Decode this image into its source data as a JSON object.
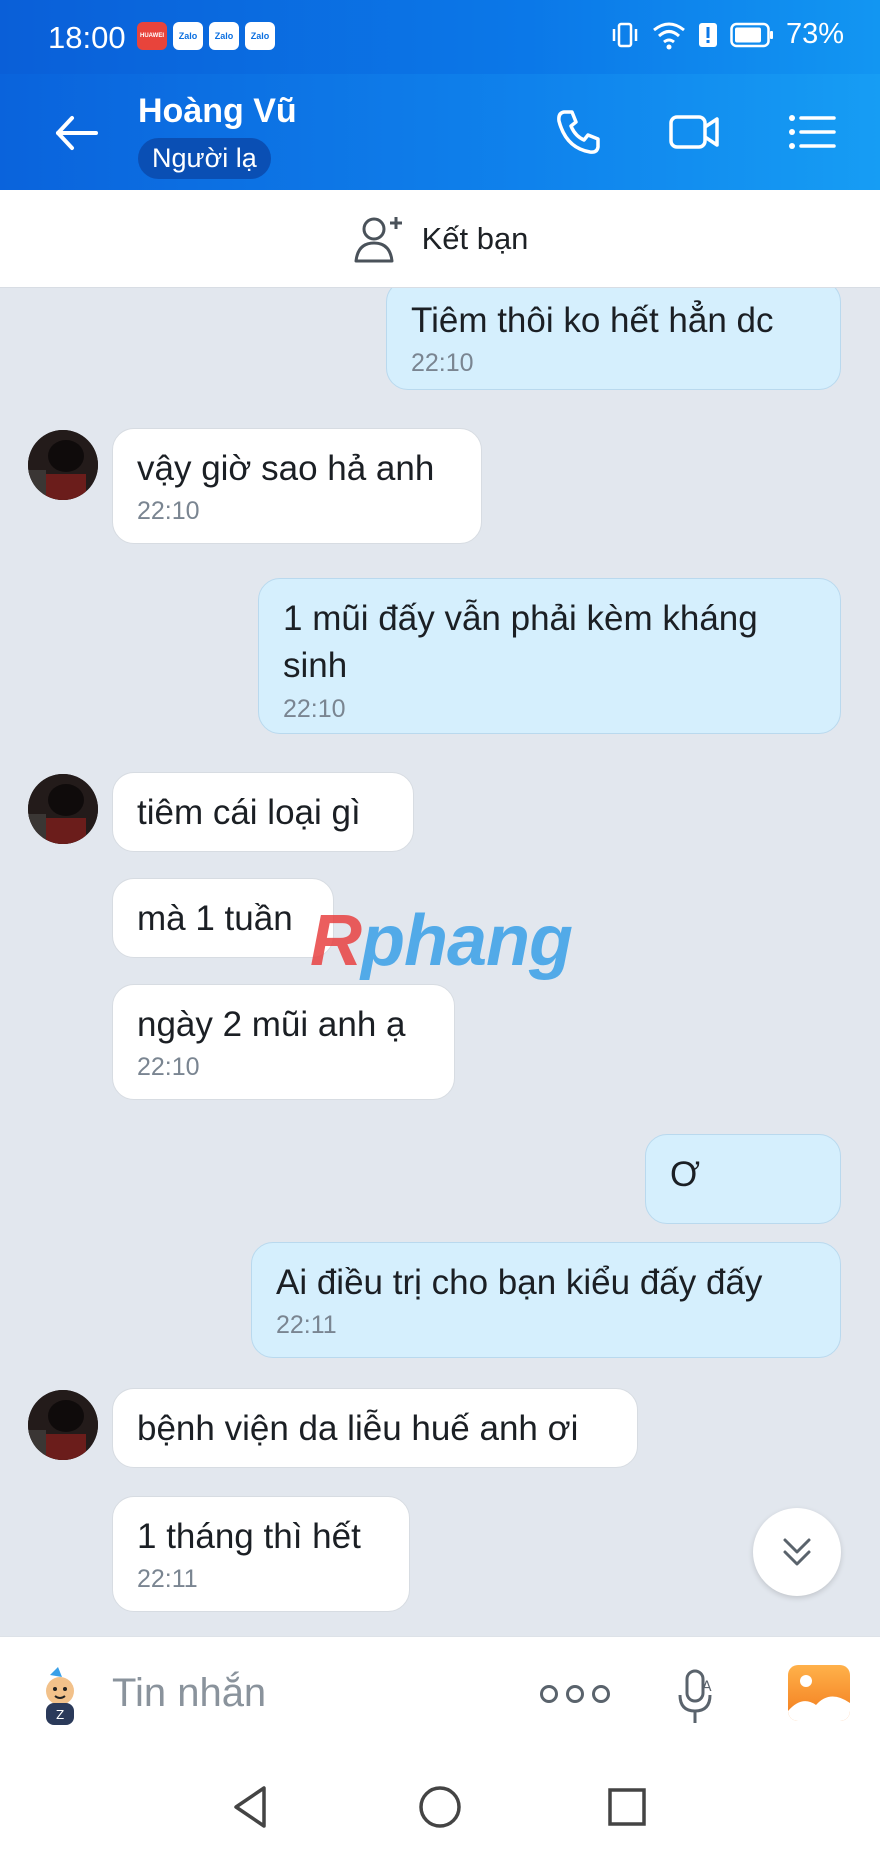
{
  "status_bar": {
    "time": "18:00",
    "apps": [
      "HUAWEI",
      "Zalo",
      "Zalo",
      "Zalo"
    ],
    "battery_percent": "73%"
  },
  "header": {
    "name": "Hoàng Vũ",
    "badge": "Người lạ"
  },
  "friend_bar": {
    "label": "Kết bạn"
  },
  "messages": [
    {
      "side": "out",
      "text": "Tiêm thôi ko hết hẳn dc",
      "time": "22:10"
    },
    {
      "side": "in",
      "text": "vậy giờ sao hả anh",
      "time": "22:10"
    },
    {
      "side": "out",
      "text": "1 mũi đấy vẫn phải kèm kháng sinh",
      "time": "22:10"
    },
    {
      "side": "in",
      "text": "tiêm cái loại gì",
      "time": ""
    },
    {
      "side": "in",
      "text": "mà 1 tuần",
      "time": ""
    },
    {
      "side": "in",
      "text": "ngày 2 mũi anh ạ",
      "time": "22:10"
    },
    {
      "side": "out",
      "text": "Ơ",
      "time": ""
    },
    {
      "side": "out",
      "text": "Ai điều trị cho bạn kiểu đấy đấy",
      "time": "22:11"
    },
    {
      "side": "in",
      "text": "bệnh viện da liễu huế anh ơi",
      "time": ""
    },
    {
      "side": "in",
      "text": "1 tháng thì hết",
      "time": "22:11"
    }
  ],
  "watermark": {
    "first": "R",
    "rest": "phang"
  },
  "input": {
    "placeholder": "Tin nhắn"
  },
  "colors": {
    "header": "#0b78e8",
    "outgoing_bubble": "#d5effd",
    "incoming_bubble": "#ffffff",
    "chat_background": "#e2e7ee"
  },
  "icons": [
    "back-arrow-icon",
    "phone-icon",
    "video-call-icon",
    "list-menu-icon",
    "add-friend-icon",
    "scroll-down-icon",
    "sticker-icon",
    "more-icon",
    "voice-icon",
    "image-icon",
    "nav-back-icon",
    "nav-home-icon",
    "nav-recent-icon"
  ]
}
